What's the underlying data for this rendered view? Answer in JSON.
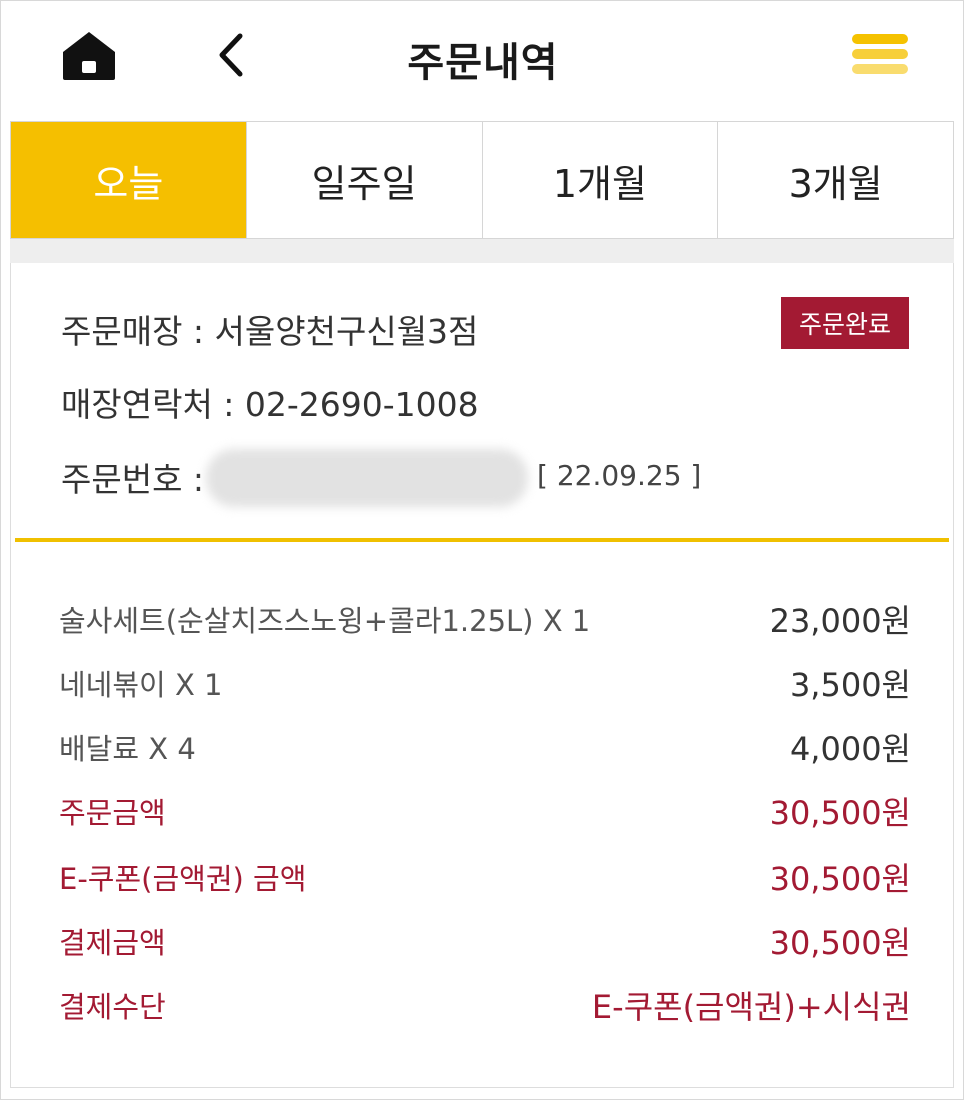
{
  "header": {
    "title": "주문내역",
    "home_icon": "home-icon",
    "back_icon": "chevron-left-icon",
    "menu_icon": "hamburger-menu-icon"
  },
  "tabs": [
    {
      "label": "오늘",
      "active": true
    },
    {
      "label": "일주일",
      "active": false
    },
    {
      "label": "1개월",
      "active": false
    },
    {
      "label": "3개월",
      "active": false
    }
  ],
  "order": {
    "store_label": "주문매장 : 서울양천구신월3점",
    "contact_label": "매장연락처 : 02-2690-1008",
    "order_no_label": "주문번호 :",
    "order_date": "[ 22.09.25 ]",
    "status": "주문완료"
  },
  "items": [
    {
      "name": "술사세트(순살치즈스노윙+콜라1.25L) X 1",
      "amount": "23,000원"
    },
    {
      "name": "네네볶이 X 1",
      "amount": "3,500원"
    },
    {
      "name": "배달료 X 4",
      "amount": "4,000원"
    }
  ],
  "summary": [
    {
      "label": "주문금액",
      "value": "30,500원"
    },
    {
      "label": "E-쿠폰(금액권) 금액",
      "value": "30,500원"
    },
    {
      "label": "결제금액",
      "value": "30,500원"
    },
    {
      "label": "결제수단",
      "value": "E-쿠폰(금액권)+시식권"
    }
  ],
  "colors": {
    "accent_yellow": "#f5bf00",
    "status_red": "#a31a33",
    "text_dark": "#1a1a1a"
  }
}
